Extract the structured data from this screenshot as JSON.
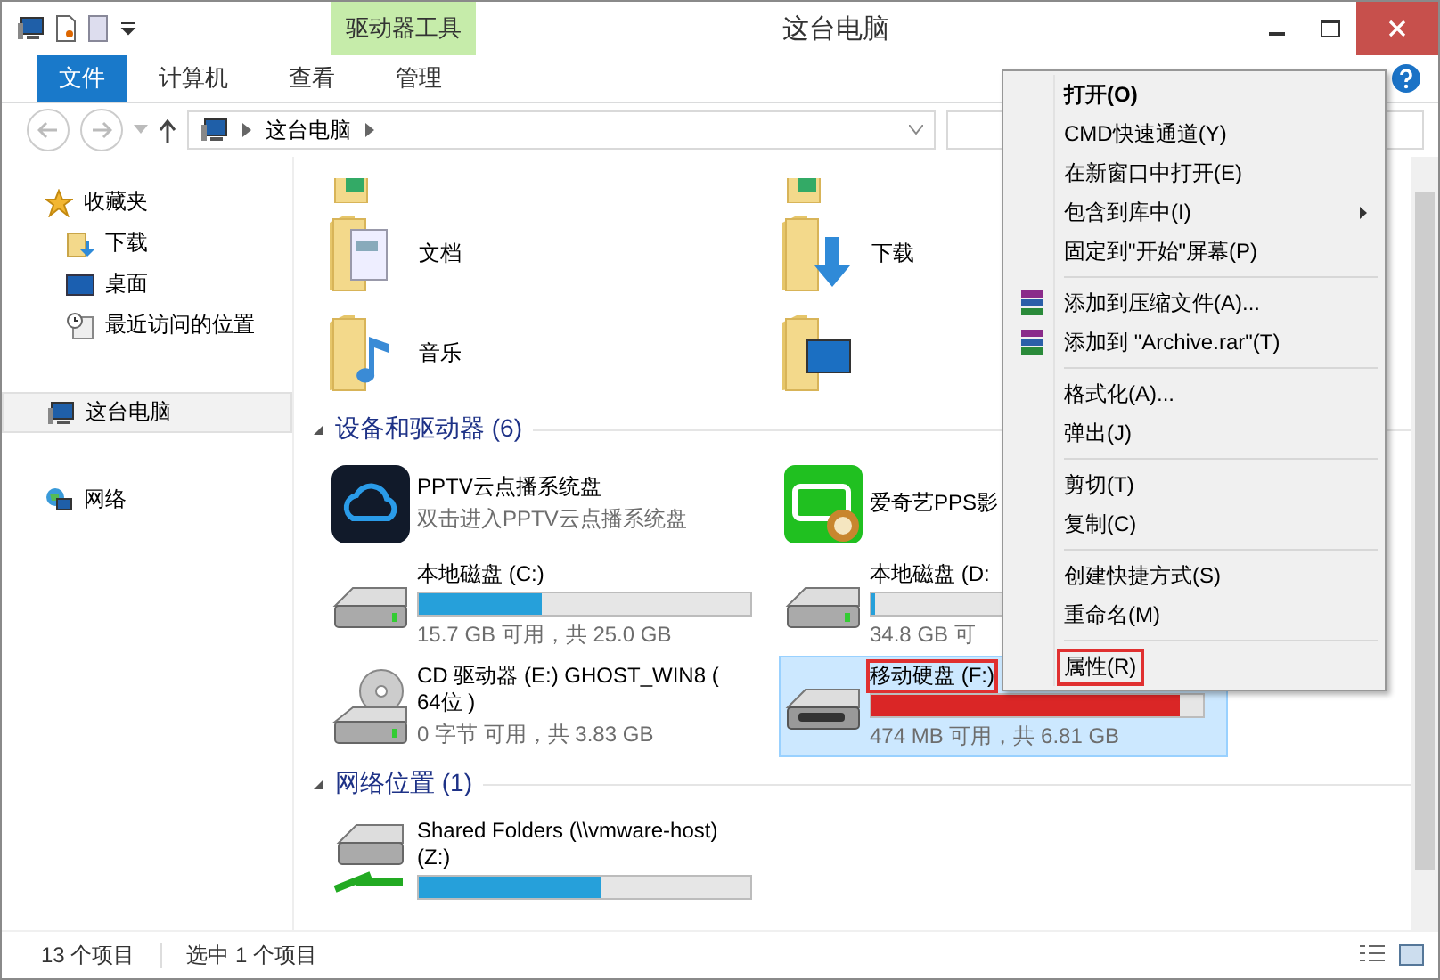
{
  "window": {
    "title": "这台电脑",
    "context_tab": "驱动器工具"
  },
  "ribbon_tabs": [
    {
      "label": "文件",
      "kind": "file",
      "selected": false
    },
    {
      "label": "计算机",
      "kind": "tab",
      "selected": false
    },
    {
      "label": "查看",
      "kind": "tab",
      "selected": false
    },
    {
      "label": "管理",
      "kind": "tab",
      "selected": false
    }
  ],
  "address_bar": {
    "path": "这台电脑"
  },
  "sidebar": {
    "items": [
      {
        "label": "收藏夹",
        "kind": "star",
        "selected": false,
        "children": [
          {
            "label": "下载",
            "kind": "download",
            "selected": false
          },
          {
            "label": "桌面",
            "kind": "desktop",
            "selected": false
          },
          {
            "label": "最近访问的位置",
            "kind": "recent",
            "selected": false
          }
        ]
      },
      {
        "label": "这台电脑",
        "kind": "pc",
        "selected": true
      },
      {
        "label": "网络",
        "kind": "network",
        "selected": false
      }
    ]
  },
  "folders": [
    {
      "name": "文档",
      "kind": "documents"
    },
    {
      "name": "下载",
      "kind": "downloads"
    },
    {
      "name": "音乐",
      "kind": "music"
    },
    {
      "kind": "desktop"
    }
  ],
  "sections": [
    {
      "title": "设备和驱动器 (6)",
      "expanded": true,
      "items": [
        {
          "kind": "cloud_app",
          "name": "PPTV云点播系统盘",
          "subtitle": "双击进入PPTV云点播系统盘",
          "selected": false,
          "highlighted": false
        },
        {
          "kind": "player_app",
          "name": "爱奇艺PPS影",
          "selected": false,
          "highlighted": false
        },
        {
          "kind": "drive",
          "name": "本地磁盘 (C:)",
          "level": 0.37,
          "free": "15.7 GB 可用，共 25.0 GB",
          "selected": false,
          "highlighted": false
        },
        {
          "kind": "drive",
          "name": "本地磁盘 (D:",
          "level": 0.01,
          "free": "34.8 GB 可",
          "selected": false,
          "highlighted": false
        },
        {
          "kind": "cd",
          "name": "CD 驱动器 (E:) GHOST_WIN8 ( 64位 )",
          "free": "0 字节 可用，共 3.83 GB",
          "selected": false,
          "highlighted": false
        },
        {
          "kind": "removable",
          "name": "移动硬盘 (F:)",
          "level": 0.93,
          "free": "474 MB 可用，共 6.81 GB",
          "selected": true,
          "highlighted": true
        }
      ]
    },
    {
      "title": "网络位置 (1)",
      "expanded": true,
      "items": [
        {
          "kind": "netdrive",
          "name": "Shared Folders (\\\\vmware-host) (Z:)",
          "level": 0.55,
          "selected": false,
          "highlighted": false
        }
      ]
    }
  ],
  "context_menu": [
    {
      "kind": "item",
      "label": "打开(O)",
      "bold": true,
      "submenu": false,
      "highlighted": false
    },
    {
      "kind": "item",
      "label": "CMD快速通道(Y)",
      "bold": false,
      "submenu": false,
      "highlighted": false
    },
    {
      "kind": "item",
      "label": "在新窗口中打开(E)",
      "bold": false,
      "submenu": false,
      "highlighted": false
    },
    {
      "kind": "item",
      "label": "包含到库中(I)",
      "bold": false,
      "submenu": true,
      "highlighted": false
    },
    {
      "kind": "item",
      "label": "固定到\"开始\"屏幕(P)",
      "bold": false,
      "submenu": false,
      "highlighted": false
    },
    {
      "kind": "separator"
    },
    {
      "kind": "archive",
      "label": "添加到压缩文件(A)...",
      "bold": false,
      "submenu": false,
      "highlighted": false
    },
    {
      "kind": "archive",
      "label": "添加到 \"Archive.rar\"(T)",
      "bold": false,
      "submenu": false,
      "highlighted": false
    },
    {
      "kind": "separator"
    },
    {
      "kind": "item",
      "label": "格式化(A)...",
      "bold": false,
      "submenu": false,
      "highlighted": false
    },
    {
      "kind": "item",
      "label": "弹出(J)",
      "bold": false,
      "submenu": false,
      "highlighted": false
    },
    {
      "kind": "separator"
    },
    {
      "kind": "item",
      "label": "剪切(T)",
      "bold": false,
      "submenu": false,
      "highlighted": false
    },
    {
      "kind": "item",
      "label": "复制(C)",
      "bold": false,
      "submenu": false,
      "highlighted": false
    },
    {
      "kind": "separator"
    },
    {
      "kind": "item",
      "label": "创建快捷方式(S)",
      "bold": false,
      "submenu": false,
      "highlighted": false
    },
    {
      "kind": "item",
      "label": "重命名(M)",
      "bold": false,
      "submenu": false,
      "highlighted": false
    },
    {
      "kind": "separator"
    },
    {
      "kind": "item",
      "label": "属性(R)",
      "bold": false,
      "submenu": false,
      "highlighted": true
    }
  ],
  "status_bar": {
    "item_count": "13 个项目",
    "selection": "选中 1 个项目"
  }
}
